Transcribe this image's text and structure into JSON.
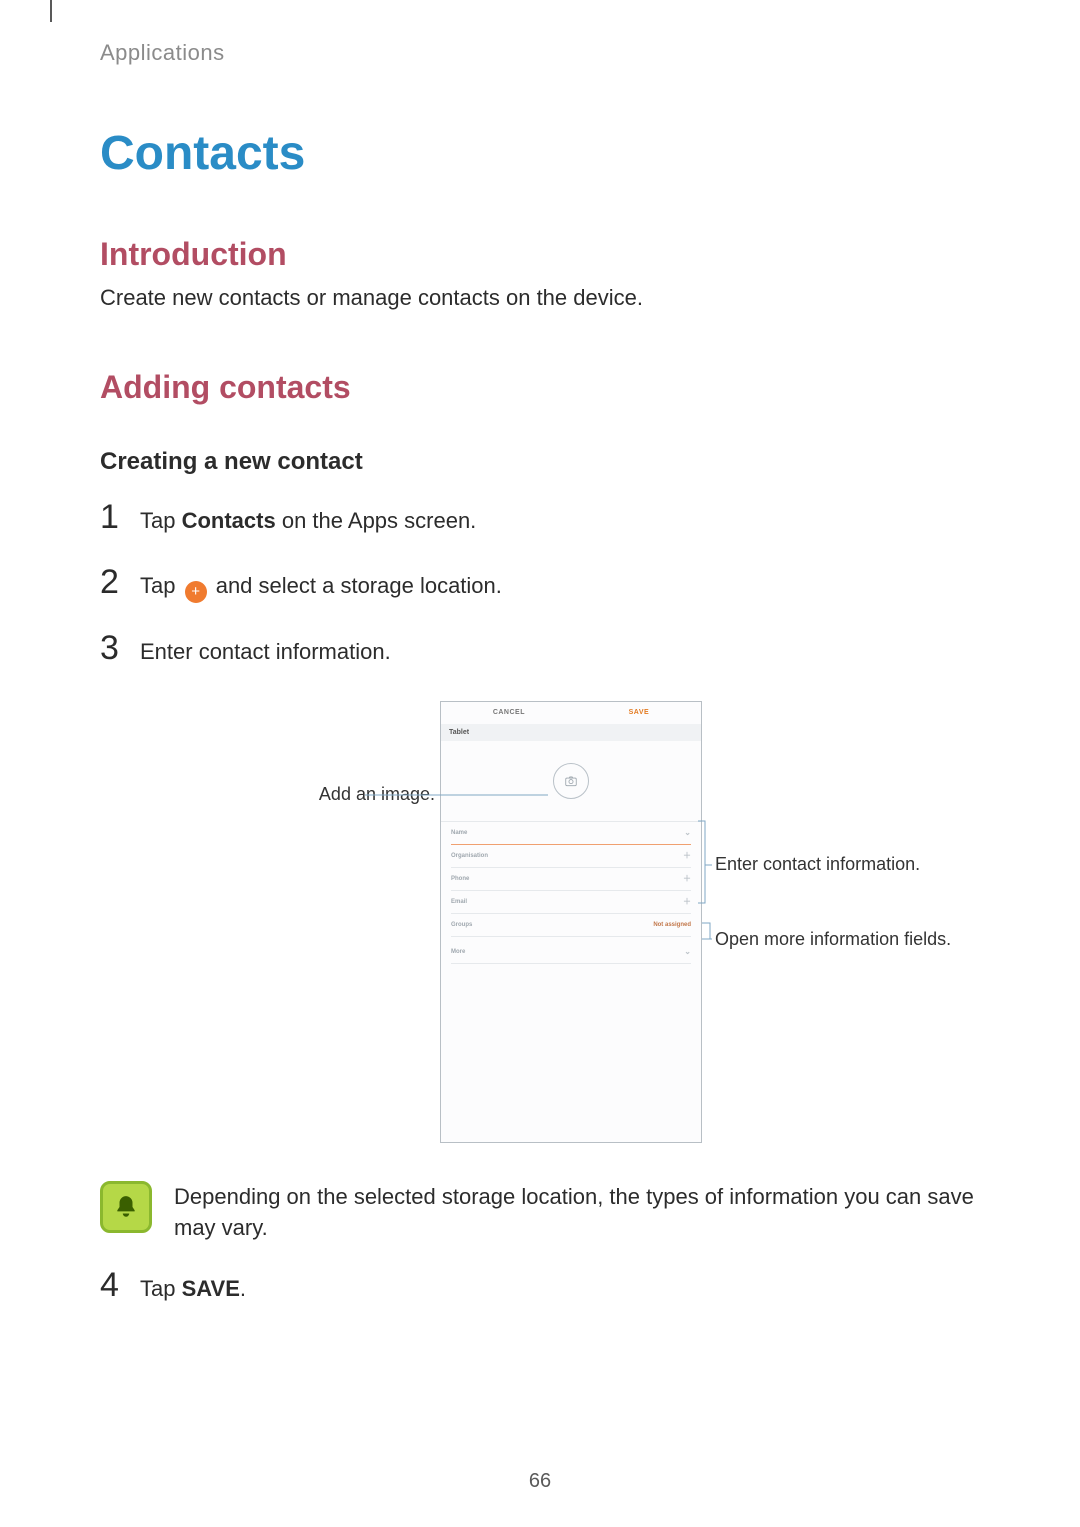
{
  "header": {
    "section": "Applications"
  },
  "title": "Contacts",
  "intro": {
    "heading": "Introduction",
    "text": "Create new contacts or manage contacts on the device."
  },
  "adding": {
    "heading": "Adding contacts",
    "sub": "Creating a new contact",
    "steps": {
      "s1": {
        "num": "1",
        "prefix": "Tap ",
        "bold": "Contacts",
        "suffix": " on the Apps screen."
      },
      "s2": {
        "num": "2",
        "prefix": "Tap ",
        "suffix": " and select a storage location."
      },
      "s3": {
        "num": "3",
        "text": "Enter contact information."
      },
      "s4": {
        "num": "4",
        "prefix": "Tap ",
        "bold": "SAVE",
        "suffix": "."
      }
    }
  },
  "diagram": {
    "labels": {
      "add_image": "Add an image.",
      "enter_info": "Enter contact information.",
      "open_more": "Open more information fields."
    },
    "phone": {
      "cancel": "CANCEL",
      "save": "SAVE",
      "status": "Tablet",
      "fields": {
        "name": "Name",
        "org": "Organisation",
        "phone": "Phone",
        "email": "Email",
        "groups": "Groups",
        "groups_value": "Not assigned",
        "more": "More"
      }
    }
  },
  "note": {
    "text": "Depending on the selected storage location, the types of information you can save may vary."
  },
  "page_number": "66"
}
